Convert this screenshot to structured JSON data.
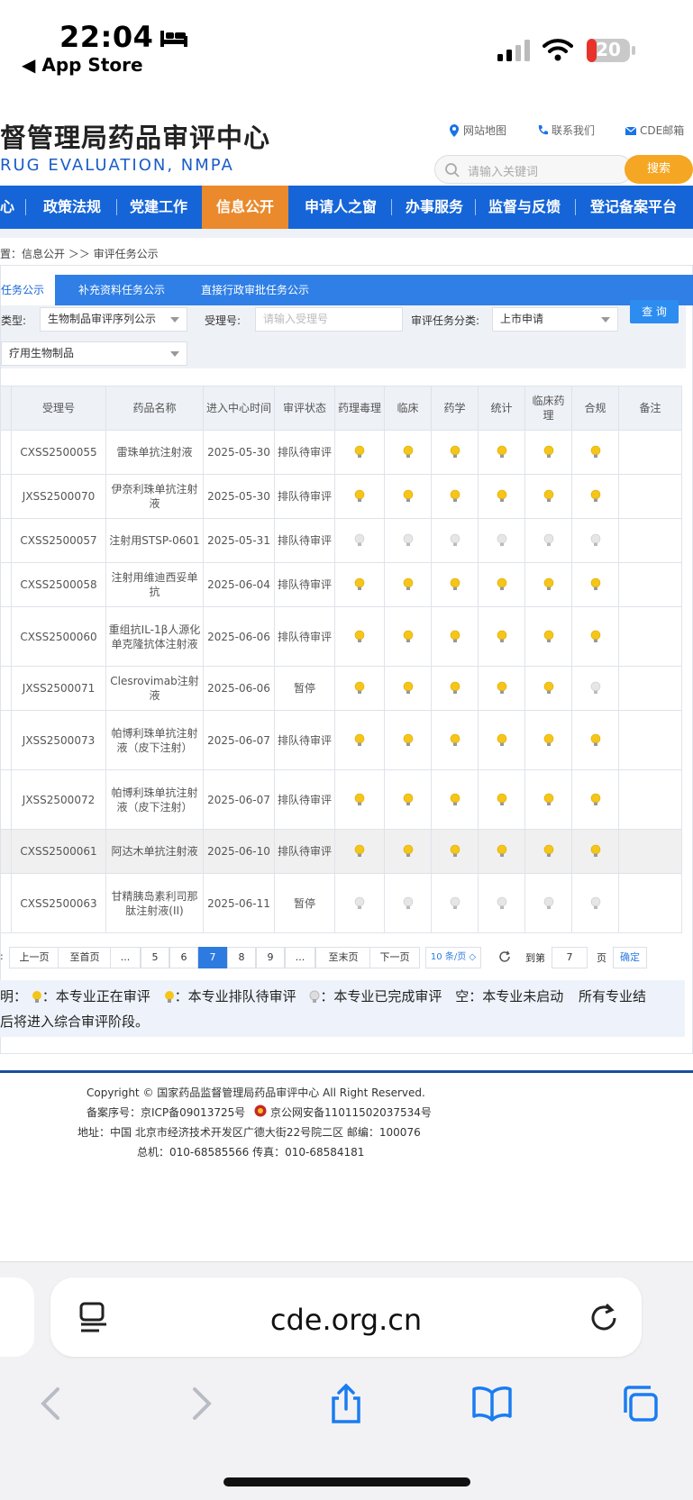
{
  "status": {
    "time": "22:04",
    "back_label": "App Store",
    "battery": "20"
  },
  "header": {
    "title": "督管理局药品审评中心",
    "subtitle": "RUG EVALUATION, NMPA",
    "links": [
      "网站地图",
      "联系我们",
      "CDE邮箱"
    ],
    "search_placeholder": "请输入关键词",
    "search_button": "搜索"
  },
  "nav": {
    "items": [
      "心",
      "政策法规",
      "党建工作",
      "信息公开",
      "申请人之窗",
      "办事服务",
      "监督与反馈",
      "登记备案平台"
    ],
    "active": "信息公开"
  },
  "breadcrumb": "置：信息公开 ＞＞ 审评任务公示",
  "tabs": [
    "任务公示",
    "补充资料任务公示",
    "直接行政审批任务公示"
  ],
  "filters": {
    "type_label": "类型:",
    "type_value": "生物制品审评序列公示",
    "accept_label": "受理号:",
    "accept_placeholder": "请输入受理号",
    "category_label": "审评任务分类:",
    "category_value": "上市申请",
    "sub_value": "疗用生物制品",
    "query_button": "查 询"
  },
  "table": {
    "headers": [
      "受理号",
      "药品名称",
      "进入中心时间",
      "审评状态",
      "药理毒理",
      "临床",
      "药学",
      "统计",
      "临床药理",
      "合规",
      "备注"
    ],
    "rows": [
      {
        "id": "CXSS2500055",
        "name": "雷珠单抗注射液",
        "date": "2025-05-30",
        "status": "排队待审评",
        "bulbs": [
          "y",
          "y",
          "y",
          "y",
          "y",
          "y"
        ]
      },
      {
        "id": "JXSS2500070",
        "name": "伊奈利珠单抗注射液",
        "date": "2025-05-30",
        "status": "排队待审评",
        "bulbs": [
          "y",
          "y",
          "y",
          "y",
          "y",
          "y"
        ]
      },
      {
        "id": "CXSS2500057",
        "name": "注射用STSP-0601",
        "date": "2025-05-31",
        "status": "排队待审评",
        "bulbs": [
          "g",
          "g",
          "g",
          "g",
          "g",
          "g"
        ]
      },
      {
        "id": "CXSS2500058",
        "name": "注射用维迪西妥单抗",
        "date": "2025-06-04",
        "status": "排队待审评",
        "bulbs": [
          "y",
          "y",
          "y",
          "y",
          "y",
          "y"
        ]
      },
      {
        "id": "CXSS2500060",
        "name": "重组抗IL-1β人源化单克隆抗体注射液",
        "date": "2025-06-06",
        "status": "排队待审评",
        "bulbs": [
          "y",
          "y",
          "y",
          "y",
          "y",
          "y"
        ]
      },
      {
        "id": "JXSS2500071",
        "name": "Clesrovimab注射液",
        "date": "2025-06-06",
        "status": "暂停",
        "bulbs": [
          "y",
          "y",
          "y",
          "y",
          "y",
          "g"
        ]
      },
      {
        "id": "JXSS2500073",
        "name": "帕博利珠单抗注射液（皮下注射）",
        "date": "2025-06-07",
        "status": "排队待审评",
        "bulbs": [
          "y",
          "y",
          "y",
          "y",
          "y",
          "y"
        ]
      },
      {
        "id": "JXSS2500072",
        "name": "帕博利珠单抗注射液（皮下注射）",
        "date": "2025-06-07",
        "status": "排队待审评",
        "bulbs": [
          "y",
          "y",
          "y",
          "y",
          "y",
          "y"
        ]
      },
      {
        "id": "CXSS2500061",
        "name": "阿达木单抗注射液",
        "date": "2025-06-10",
        "status": "排队待审评",
        "bulbs": [
          "y",
          "y",
          "y",
          "y",
          "y",
          "y"
        ]
      },
      {
        "id": "CXSS2500063",
        "name": "甘精胰岛素利司那肽注射液(II)",
        "date": "2025-06-11",
        "status": "暂停",
        "bulbs": [
          "g",
          "g",
          "g",
          "g",
          "g",
          "g"
        ]
      }
    ]
  },
  "pager": {
    "prev": "上一页",
    "first": "至首页",
    "ellipsis": "...",
    "pages": [
      "5",
      "6",
      "7",
      "8",
      "9"
    ],
    "current": "7",
    "last": "至末页",
    "next": "下一页",
    "page_size": "10 条/页",
    "goto_label": "到第",
    "goto_value": "7",
    "page_unit": "页",
    "confirm": "确定"
  },
  "legend": {
    "line1_prefix": "明：",
    "in_review": "：本专业正在审评",
    "queued": "：本专业排队待审评",
    "done": "：本专业已完成审评",
    "empty": "空：本专业未启动",
    "all_prefix": "所有专业结",
    "line2": "后将进入综合审评阶段。"
  },
  "footer": {
    "copyright": "Copyright © 国家药品监督管理局药品审评中心    All Right Reserved.",
    "icp": "备案序号：京ICP备09013725号",
    "police": "京公网安备11011502037534号",
    "address": "地址：中国 北京市经济技术开发区广德大街22号院二区      邮编：100076",
    "phone": "总机：010-68585566      传真：010-68584181"
  },
  "safari": {
    "url": "cde.org.cn"
  },
  "colors": {
    "nav_blue": "#1565d8",
    "nav_active": "#ea8a2c",
    "search_orange": "#f5a623",
    "bulb_yellow": "#f5c518",
    "bulb_gray": "#c8c8c8"
  }
}
